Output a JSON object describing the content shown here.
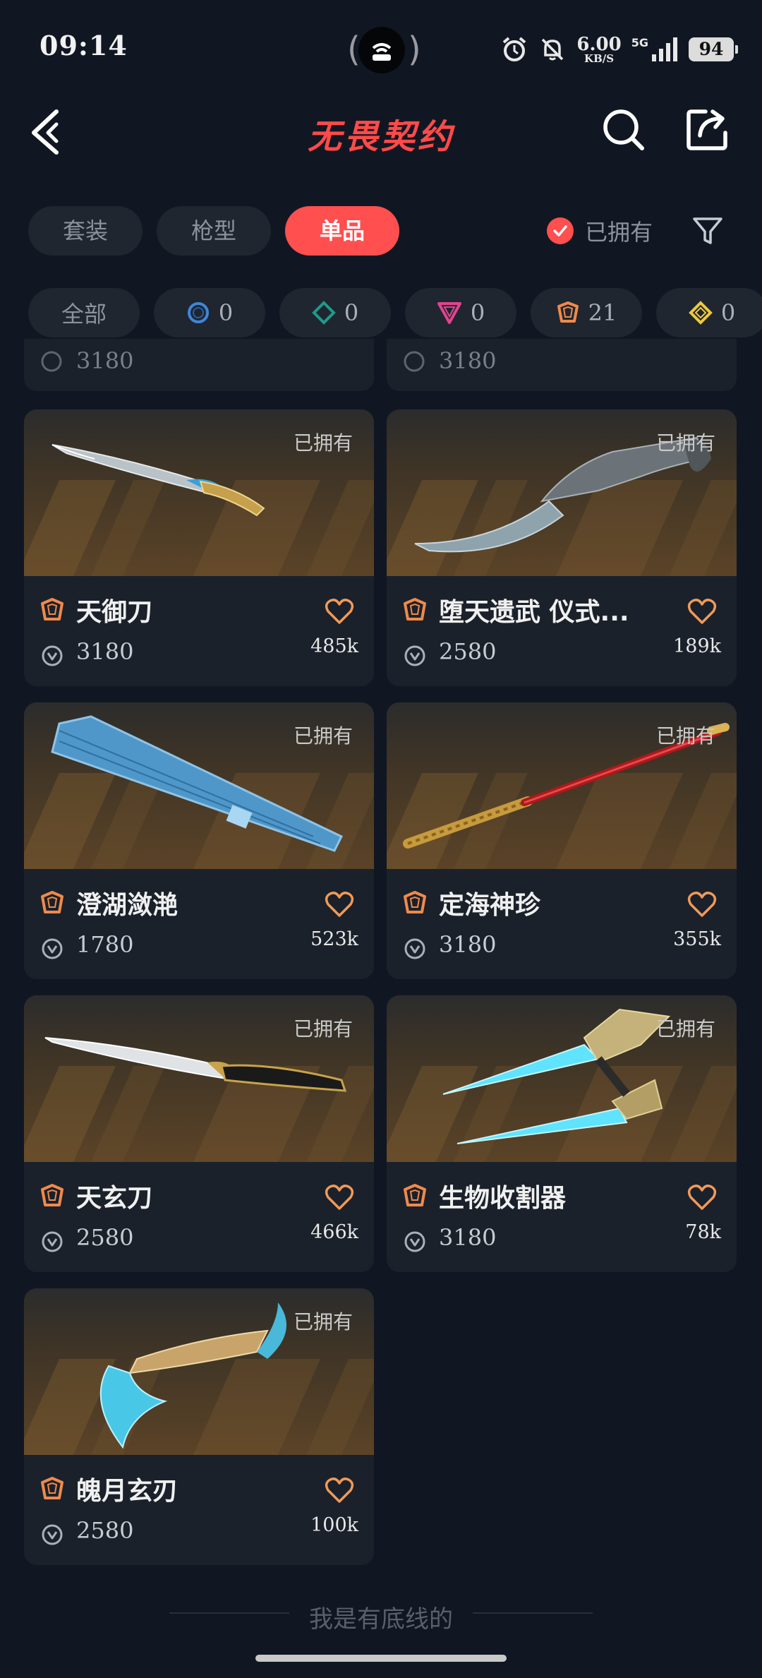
{
  "status_bar": {
    "time": "09:14",
    "speed_value": "6.00",
    "speed_unit": "KB/S",
    "network": "5G",
    "battery": "94"
  },
  "header": {
    "title": "无畏契约"
  },
  "tabs": [
    {
      "label": "套装",
      "active": false
    },
    {
      "label": "枪型",
      "active": false
    },
    {
      "label": "单品",
      "active": true
    }
  ],
  "owned_filter": {
    "label": "已拥有",
    "checked": true
  },
  "rarity_chips": [
    {
      "label": "全部"
    },
    {
      "icon": "blue-circle-tier-icon",
      "count": "0",
      "color": "#3f86d8"
    },
    {
      "icon": "teal-diamond-tier-icon",
      "count": "0",
      "color": "#1f9a8a"
    },
    {
      "icon": "pink-triangle-tier-icon",
      "count": "0",
      "color": "#e0448f"
    },
    {
      "icon": "orange-pentagon-tier-icon",
      "count": "21",
      "color": "#f08a4b"
    },
    {
      "icon": "yellow-diamond-tier-icon",
      "count": "0",
      "color": "#f0c93a"
    }
  ],
  "partial_prices": [
    "3180",
    "3180"
  ],
  "items": [
    {
      "name": "天御刀",
      "owned_label": "已拥有",
      "price": "3180",
      "likes": "485k",
      "art": "curved-blade-gold"
    },
    {
      "name": "堕天遗武 仪式...",
      "owned_label": "已拥有",
      "price": "2580",
      "likes": "189k",
      "art": "karambit-steel"
    },
    {
      "name": "澄湖潋滟",
      "owned_label": "已拥有",
      "price": "1780",
      "likes": "523k",
      "art": "folding-fan-blue"
    },
    {
      "name": "定海神珍",
      "owned_label": "已拥有",
      "price": "3180",
      "likes": "355k",
      "art": "staff-red-gold"
    },
    {
      "name": "天玄刀",
      "owned_label": "已拥有",
      "price": "2580",
      "likes": "466k",
      "art": "straight-blade-silver"
    },
    {
      "name": "生物收割器",
      "owned_label": "已拥有",
      "price": "3180",
      "likes": "78k",
      "art": "twin-blades-cyan"
    },
    {
      "name": "魄月玄刃",
      "owned_label": "已拥有",
      "price": "2580",
      "likes": "100k",
      "art": "crescent-blade-cyan"
    }
  ],
  "footer": {
    "text": "我是有底线的"
  }
}
